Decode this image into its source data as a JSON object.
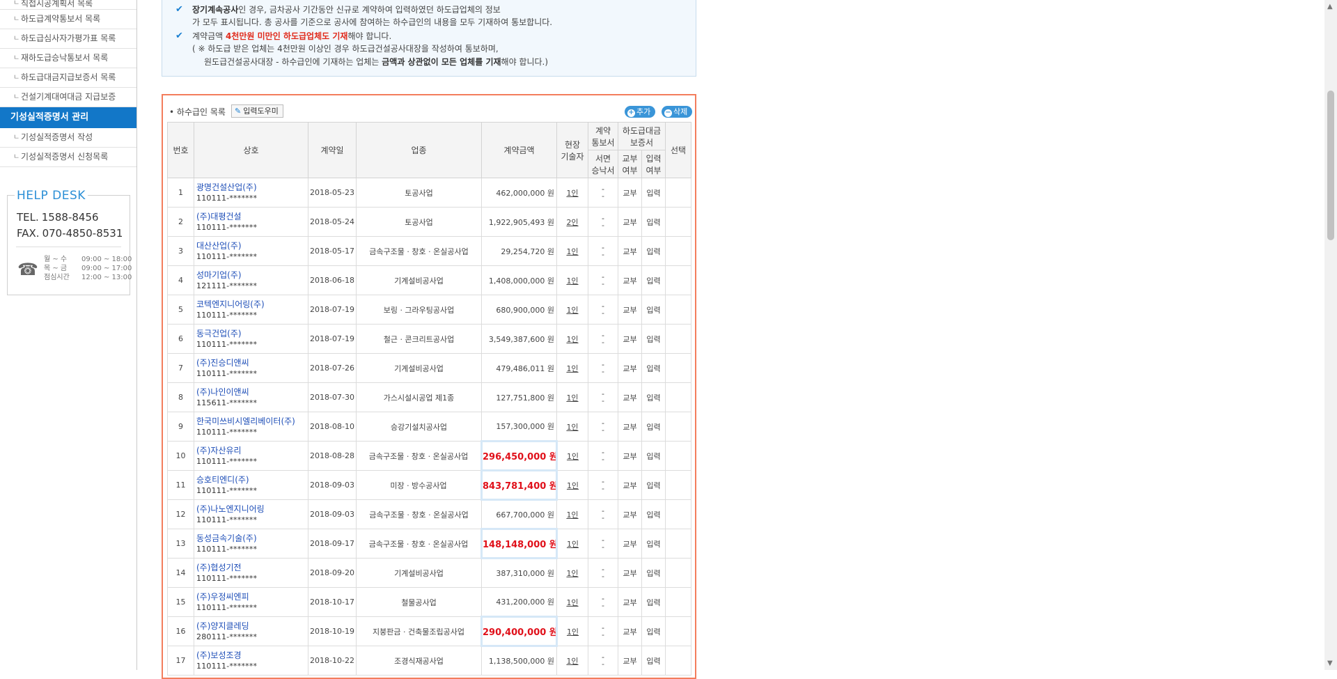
{
  "sidebar": {
    "items": [
      {
        "label": "직접시공계획서 목록"
      },
      {
        "label": "하도급계약통보서 목록"
      },
      {
        "label": "하도급심사자가평가표 목록"
      },
      {
        "label": "재하도급승낙통보서 목록"
      },
      {
        "label": "하도급대금지급보증서 목록"
      },
      {
        "label": "건설기계대여대금 지급보증"
      }
    ],
    "section_title": "기성실적증명서 관리",
    "sub_items": [
      {
        "label": "기성실적증명서 작성"
      },
      {
        "label": "기성실적증명서 신청목록"
      }
    ]
  },
  "helpdesk": {
    "title": "HELP DESK",
    "tel_label": "TEL.",
    "tel": "1588-8456",
    "fax_label": "FAX.",
    "fax": "070-4850-8531",
    "hours": [
      {
        "days": "월 ~ 수",
        "time": "09:00 ~ 18:00"
      },
      {
        "days": "목 ~ 금",
        "time": "09:00 ~ 17:00"
      },
      {
        "days": "점심시간",
        "time": "12:00 ~ 13:00"
      }
    ]
  },
  "notice": {
    "line1_bold": "장기계속공사",
    "line1_rest": "인 경우, 금차공사 기간동안 신규로 계약하여 입력하였던 하도급업체의 정보",
    "line1b": "가 모두 표시됩니다. 총 공사를 기준으로 공사에 참여하는 하수급인의 내용을 모두 기재하여 통보합니다.",
    "line2_pre": "계약금액 ",
    "line2_red": "4천만원 미만인 하도급업체도 기재",
    "line2_post": "해야 합니다.",
    "line3": "( ※ 하도급 받은 업체는 4천만원 이상인 경우 하도급건설공사대장을 작성하여 통보하며,",
    "line4_pre": "원도급건설공사대장 - 하수급인에 기재하는 업체는 ",
    "line4_bold": "금액과 상관없이 모든 업체를 기재",
    "line4_post": "해야 합니다.)"
  },
  "list": {
    "title": "하수급인 목록",
    "helper_button": "입력도우미",
    "add_button": "추가",
    "delete_button": "삭제",
    "headers": {
      "no": "번호",
      "company": "상호",
      "contract_date": "계약일",
      "industry": "업종",
      "amount": "계약금액",
      "site_tech_1": "현장",
      "site_tech_2": "기술자",
      "contract_notice_1": "계약",
      "contract_notice_2": "통보서",
      "written_consent_1": "서면",
      "written_consent_2": "승낙서",
      "payment_guarantee": "하도급대금",
      "payment_guarantee_2": "보증서",
      "issued_1": "교부",
      "issued_2": "여부",
      "entered_1": "입력",
      "entered_2": "여부",
      "select": "선택"
    },
    "rows": [
      {
        "no": "1",
        "name": "광명건설산업(주)",
        "biz": "110111-*******",
        "date": "2018-05-23",
        "industry": "토공사업",
        "amount": "462,000,000 원",
        "highlight": false,
        "tech": "1인",
        "issued": "교부",
        "entered": "입력"
      },
      {
        "no": "2",
        "name": "(주)대평건설",
        "biz": "110111-*******",
        "date": "2018-05-24",
        "industry": "토공사업",
        "amount": "1,922,905,493 원",
        "highlight": false,
        "tech": "2인",
        "issued": "교부",
        "entered": "입력"
      },
      {
        "no": "3",
        "name": "대산산업(주)",
        "biz": "110111-*******",
        "date": "2018-05-17",
        "industry": "금속구조물 · 창호 · 온실공사업",
        "amount": "29,254,720 원",
        "highlight": false,
        "tech": "1인",
        "issued": "교부",
        "entered": "입력"
      },
      {
        "no": "4",
        "name": "성마기업(주)",
        "biz": "121111-*******",
        "date": "2018-06-18",
        "industry": "기계설비공사업",
        "amount": "1,408,000,000 원",
        "highlight": false,
        "tech": "1인",
        "issued": "교부",
        "entered": "입력"
      },
      {
        "no": "5",
        "name": "코텍엔지니어링(주)",
        "biz": "110111-*******",
        "date": "2018-07-19",
        "industry": "보링 · 그라우팅공사업",
        "amount": "680,900,000 원",
        "highlight": false,
        "tech": "1인",
        "issued": "교부",
        "entered": "입력"
      },
      {
        "no": "6",
        "name": "동극건업(주)",
        "biz": "110111-*******",
        "date": "2018-07-19",
        "industry": "철근 · 콘크리트공사업",
        "amount": "3,549,387,600 원",
        "highlight": false,
        "tech": "1인",
        "issued": "교부",
        "entered": "입력"
      },
      {
        "no": "7",
        "name": "(주)진승디앤씨",
        "biz": "110111-*******",
        "date": "2018-07-26",
        "industry": "기계설비공사업",
        "amount": "479,486,011 원",
        "highlight": false,
        "tech": "1인",
        "issued": "교부",
        "entered": "입력"
      },
      {
        "no": "8",
        "name": "(주)나인이앤씨",
        "biz": "115611-*******",
        "date": "2018-07-30",
        "industry": "가스시설시공업 제1종",
        "amount": "127,751,800 원",
        "highlight": false,
        "tech": "1인",
        "issued": "교부",
        "entered": "입력"
      },
      {
        "no": "9",
        "name": "한국미쓰비시엘리베이터(주)",
        "biz": "110111-*******",
        "date": "2018-08-10",
        "industry": "승강기설치공사업",
        "amount": "157,300,000 원",
        "highlight": false,
        "tech": "1인",
        "issued": "교부",
        "entered": "입력"
      },
      {
        "no": "10",
        "name": "(주)자산유리",
        "biz": "110111-*******",
        "date": "2018-08-28",
        "industry": "금속구조물 · 창호 · 온실공사업",
        "amount": "296,450,000 원",
        "highlight": true,
        "tech": "1인",
        "issued": "교부",
        "entered": "입력"
      },
      {
        "no": "11",
        "name": "승호티엔디(주)",
        "biz": "110111-*******",
        "date": "2018-09-03",
        "industry": "미장 · 방수공사업",
        "amount": "843,781,400 원",
        "highlight": true,
        "tech": "1인",
        "issued": "교부",
        "entered": "입력"
      },
      {
        "no": "12",
        "name": "(주)나노엔지니어링",
        "biz": "110111-*******",
        "date": "2018-09-03",
        "industry": "금속구조물 · 창호 · 온실공사업",
        "amount": "667,700,000 원",
        "highlight": false,
        "tech": "1인",
        "issued": "교부",
        "entered": "입력"
      },
      {
        "no": "13",
        "name": "동성금속기술(주)",
        "biz": "110111-*******",
        "date": "2018-09-17",
        "industry": "금속구조물 · 창호 · 온실공사업",
        "amount": "148,148,000 원",
        "highlight": true,
        "tech": "1인",
        "issued": "교부",
        "entered": "입력"
      },
      {
        "no": "14",
        "name": "(주)협성기전",
        "biz": "110111-*******",
        "date": "2018-09-20",
        "industry": "기계설비공사업",
        "amount": "387,310,000 원",
        "highlight": false,
        "tech": "1인",
        "issued": "교부",
        "entered": "입력"
      },
      {
        "no": "15",
        "name": "(주)우정씨엔피",
        "biz": "110111-*******",
        "date": "2018-10-17",
        "industry": "철물공사업",
        "amount": "431,200,000 원",
        "highlight": false,
        "tech": "1인",
        "issued": "교부",
        "entered": "입력"
      },
      {
        "no": "16",
        "name": "(주)양지클레딩",
        "biz": "280111-*******",
        "date": "2018-10-19",
        "industry": "지붕판금 · 건축물조립공사업",
        "amount": "290,400,000 원",
        "highlight": true,
        "tech": "1인",
        "issued": "교부",
        "entered": "입력"
      },
      {
        "no": "17",
        "name": "(주)보성조경",
        "biz": "110111-*******",
        "date": "2018-10-22",
        "industry": "조경식재공사업",
        "amount": "1,138,500,000 원",
        "highlight": false,
        "tech": "1인",
        "issued": "교부",
        "entered": "입력"
      }
    ],
    "dash_top": "-",
    "dash_bottom": "-"
  }
}
